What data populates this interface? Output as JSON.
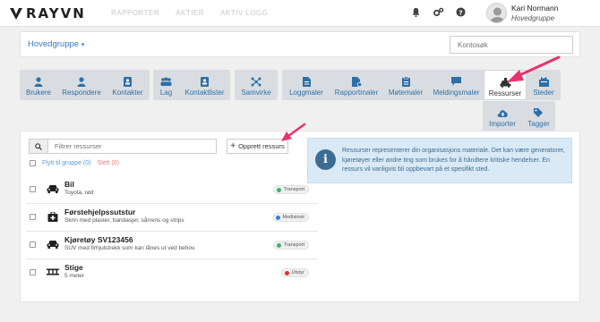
{
  "brand": {
    "name": "RAYVN"
  },
  "nav": {
    "items": [
      "RAPPORTER",
      "AKTIER",
      "AKTIV LOGG"
    ]
  },
  "user": {
    "name": "Kari Normann",
    "group": "Hovedgruppe"
  },
  "group_selector": {
    "label": "Hovedgruppe"
  },
  "contact_search": {
    "placeholder": "Kontosøk"
  },
  "toolbar": {
    "brukere": "Brukere",
    "respondere": "Respondere",
    "kontakter": "Kontakter",
    "lag": "Lag",
    "kontaktlister": "Kontaktlister",
    "samvirke": "Samvirke",
    "loggmaler": "Loggmaler",
    "rapportmaler": "Rapportmaler",
    "motemaler": "Møtemaler",
    "meldingsmaler": "Meldingsmaler",
    "ressurser": "Ressurser",
    "steder": "Steder",
    "importer": "Importer",
    "tagger": "Tagger"
  },
  "filter": {
    "placeholder": "Filtrer ressurser"
  },
  "create_button": {
    "label": "Opprett ressurs"
  },
  "bulk": {
    "move": "Flytt til gruppe (0)",
    "delete": "Slett (0)"
  },
  "resources": [
    {
      "name": "Bil",
      "desc": "Toyota, rød",
      "tag": "Transport",
      "tag_color": "#3cb371",
      "icon": "car-icon"
    },
    {
      "name": "Førstehjelpssutstur",
      "desc": "Skrin med plaster, bandasjer, sårrens og strips",
      "tag": "Medisinsk",
      "tag_color": "#3b7dd8",
      "icon": "first-aid-kit-icon"
    },
    {
      "name": "Kjøretøy SV123456",
      "desc": "SUV med firhjulstrekk som kan lånes ut ved behov.",
      "tag": "Transport",
      "tag_color": "#3cb371",
      "icon": "car-icon"
    },
    {
      "name": "Stige",
      "desc": "5 meter",
      "tag": "Utstyr",
      "tag_color": "#e03030",
      "icon": "ladder-icon"
    }
  ],
  "info": {
    "text": "Ressurser representerer din organisasjons materiale. Det kan være generatorer, kjøretøyer eller andre ting som brukes for å håndtere kritiske hendelser. En ressurs vil vanligvis bli oppbevart på et spesifikt sted."
  },
  "colors": {
    "accent": "#2f6fa8",
    "arrow": "#e8336d",
    "info_bg": "#d9e9f5"
  }
}
